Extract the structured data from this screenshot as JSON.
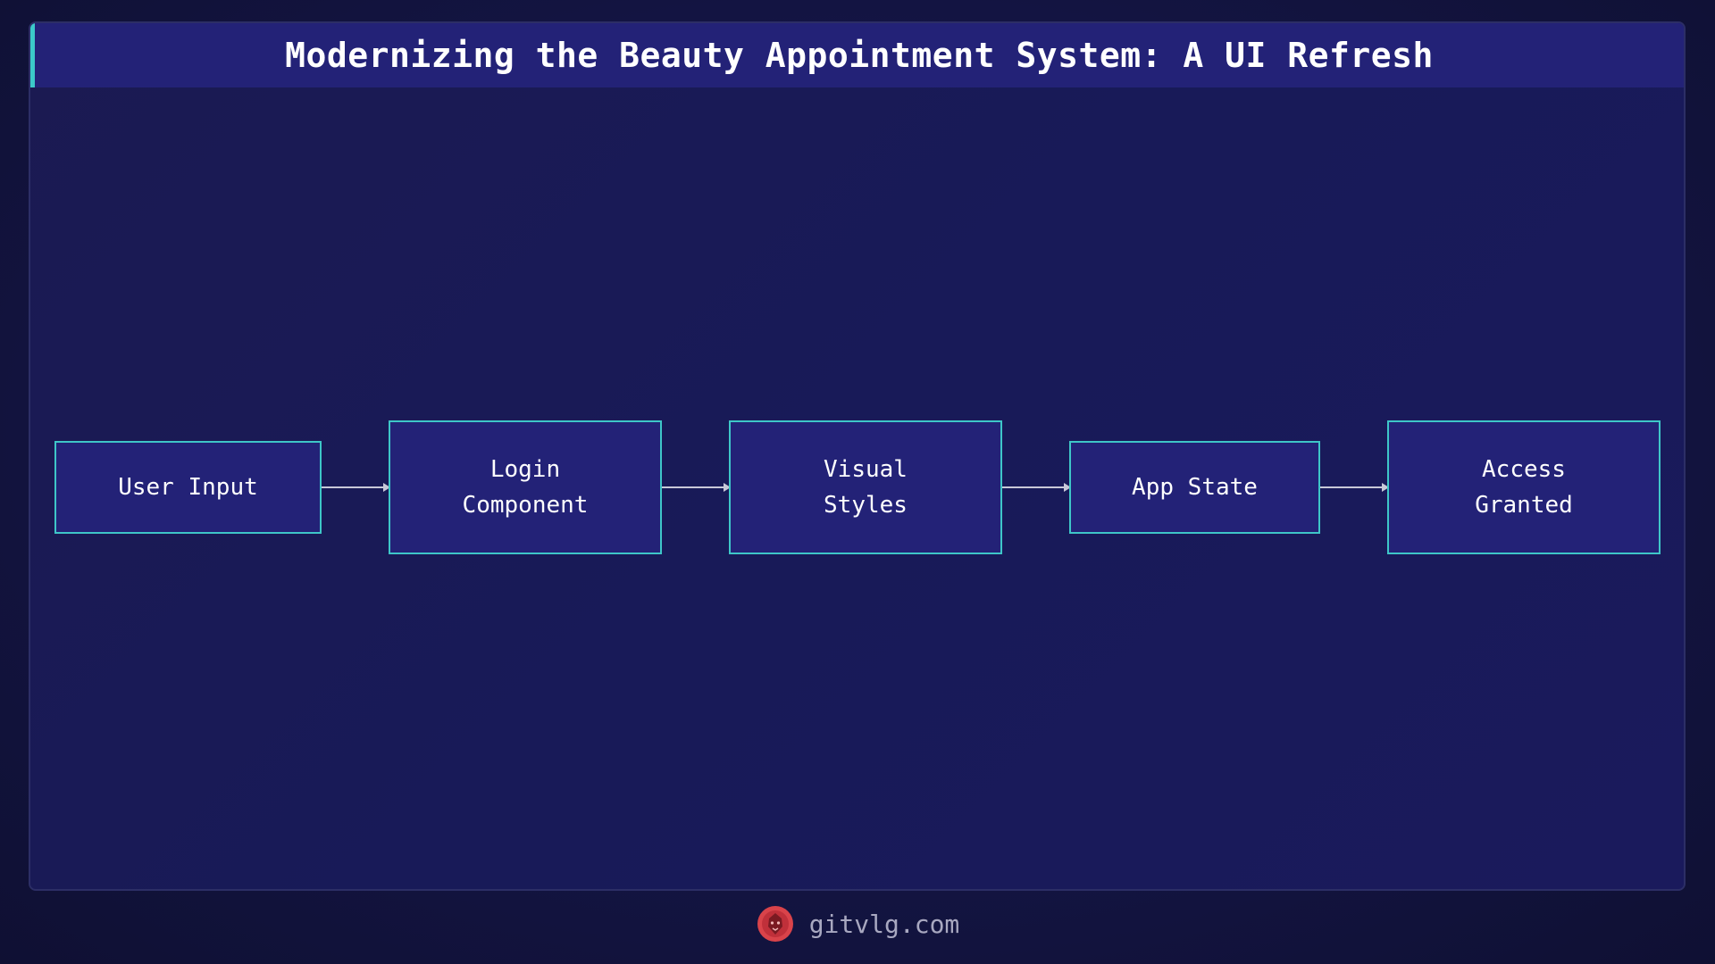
{
  "title": "Modernizing the Beauty Appointment System: A UI Refresh",
  "nodes": [
    {
      "label": "User Input"
    },
    {
      "label": "Login\nComponent"
    },
    {
      "label": "Visual\nStyles"
    },
    {
      "label": "App State"
    },
    {
      "label": "Access\nGranted"
    }
  ],
  "footer": {
    "site": "gitvlg.com",
    "logo_icon": "lion-head-icon"
  },
  "colors": {
    "background": "#131441",
    "node_fill": "#232277",
    "node_border": "#3ec6c8",
    "accent": "#3cc9c9",
    "logo": "#d9434a"
  }
}
